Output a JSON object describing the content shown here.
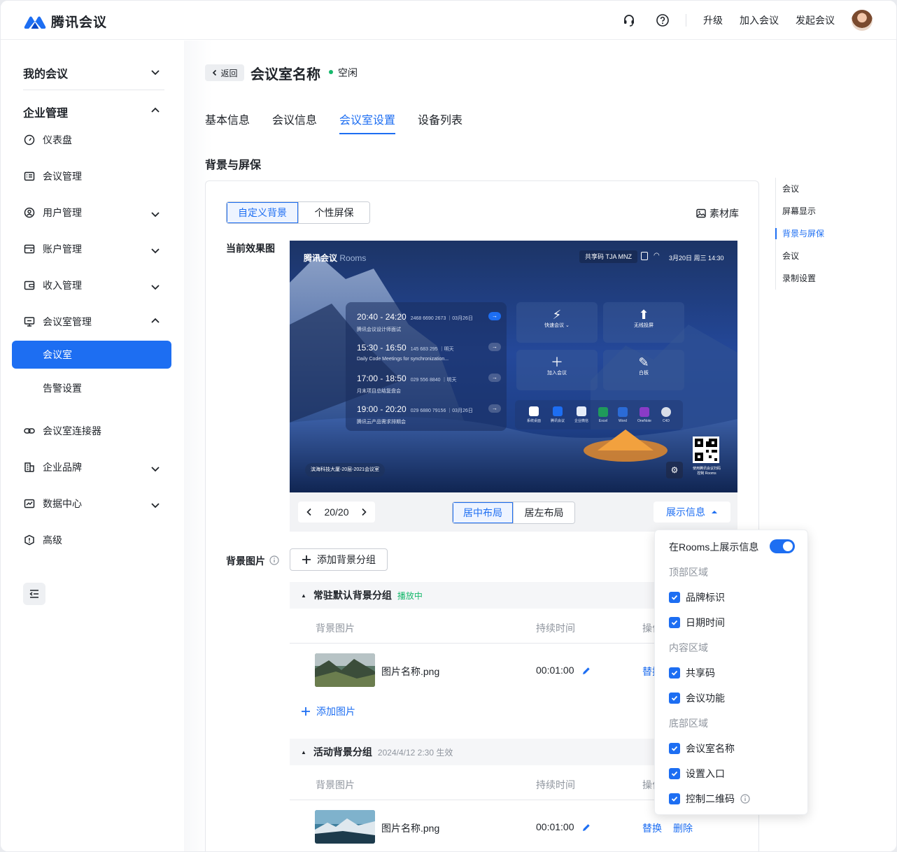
{
  "app": {
    "name": "腾讯会议"
  },
  "topbar": {
    "upgrade": "升级",
    "join": "加入会议",
    "start": "发起会议"
  },
  "sidebar": {
    "my_meetings": "我的会议",
    "enterprise": "企业管理",
    "items": [
      {
        "label": "仪表盘"
      },
      {
        "label": "会议管理"
      },
      {
        "label": "用户管理"
      },
      {
        "label": "账户管理"
      },
      {
        "label": "收入管理"
      },
      {
        "label": "会议室管理"
      },
      {
        "label": "会议室"
      },
      {
        "label": "告警设置"
      },
      {
        "label": "会议室连接器"
      },
      {
        "label": "企业品牌"
      },
      {
        "label": "数据中心"
      },
      {
        "label": "高级"
      }
    ]
  },
  "header": {
    "back": "返回",
    "room_name": "会议室名称",
    "status": "空闲"
  },
  "tabs": [
    "基本信息",
    "会议信息",
    "会议室设置",
    "设备列表"
  ],
  "section": {
    "title": "背景与屏保"
  },
  "card": {
    "seg": [
      "自定义背景",
      "个性屏保"
    ],
    "library": "素材库",
    "current_label": "当前效果图",
    "pager": "20/20",
    "layout": [
      "居中布局",
      "居左布局"
    ],
    "show_info": "展示信息",
    "bg_label": "背景图片",
    "add_group": "添加背景分组",
    "groups": [
      {
        "name": "常驻默认背景分组",
        "tag": "播放中",
        "col_image": "背景图片",
        "col_duration": "持续时间",
        "col_action": "操作",
        "row": {
          "name": "图片名称.png",
          "duration": "00:01:00",
          "replace": "替换"
        },
        "add_image": "添加图片"
      },
      {
        "name": "活动背景分组",
        "date": "2024/4/12 2:30 生效",
        "col_image": "背景图片",
        "col_duration": "持续时间",
        "col_action": "操作",
        "row": {
          "name": "图片名称.png",
          "duration": "00:01:00",
          "replace": "替换",
          "delete": "删除"
        }
      }
    ]
  },
  "preview": {
    "brand": "腾讯会议",
    "brand_suffix": "Rooms",
    "share_code": "共享码 TJA MNZ",
    "datetime": "3月20日 周三 14:30",
    "meetings": [
      {
        "time": "20:40 - 24:20",
        "meta": "2468 6690 2673 ｜03月26日",
        "title": "腾讯会议设计师面试"
      },
      {
        "time": "15:30 - 16:50",
        "meta": "145 683 295 ｜明天",
        "title": "Daily Code Meetings for synchronization..."
      },
      {
        "time": "17:00 - 18:50",
        "meta": "029 556 8840 ｜明天",
        "title": "月末项目总结复盘会"
      },
      {
        "time": "19:00 - 20:20",
        "meta": "029 6880 79156 ｜03月26日",
        "title": "腾讯云产品需求排期会"
      }
    ],
    "tiles": [
      "快速会议 ⌄",
      "无线投屏",
      "加入会议",
      "白板"
    ],
    "apps": [
      "系统桌面",
      "腾讯会议",
      "企业微信",
      "Excel",
      "Word",
      "OneNote",
      "C4D"
    ],
    "location": "滨海科技大厦-20层-2021会议室",
    "qr_text": "使用腾讯会议扫码控制 Rooms"
  },
  "anchors": [
    "会议",
    "屏幕显示",
    "背景与屏保",
    "会议",
    "录制设置"
  ],
  "dropdown": {
    "toggle_label": "在Rooms上展示信息",
    "sections": [
      {
        "title": "顶部区域",
        "items": [
          "品牌标识",
          "日期时间"
        ]
      },
      {
        "title": "内容区域",
        "items": [
          "共享码",
          "会议功能"
        ]
      },
      {
        "title": "底部区域",
        "items": [
          "会议室名称",
          "设置入口",
          "控制二维码"
        ]
      }
    ]
  },
  "colors": {
    "accent": "#1d6ef2",
    "success": "#16b86c"
  }
}
